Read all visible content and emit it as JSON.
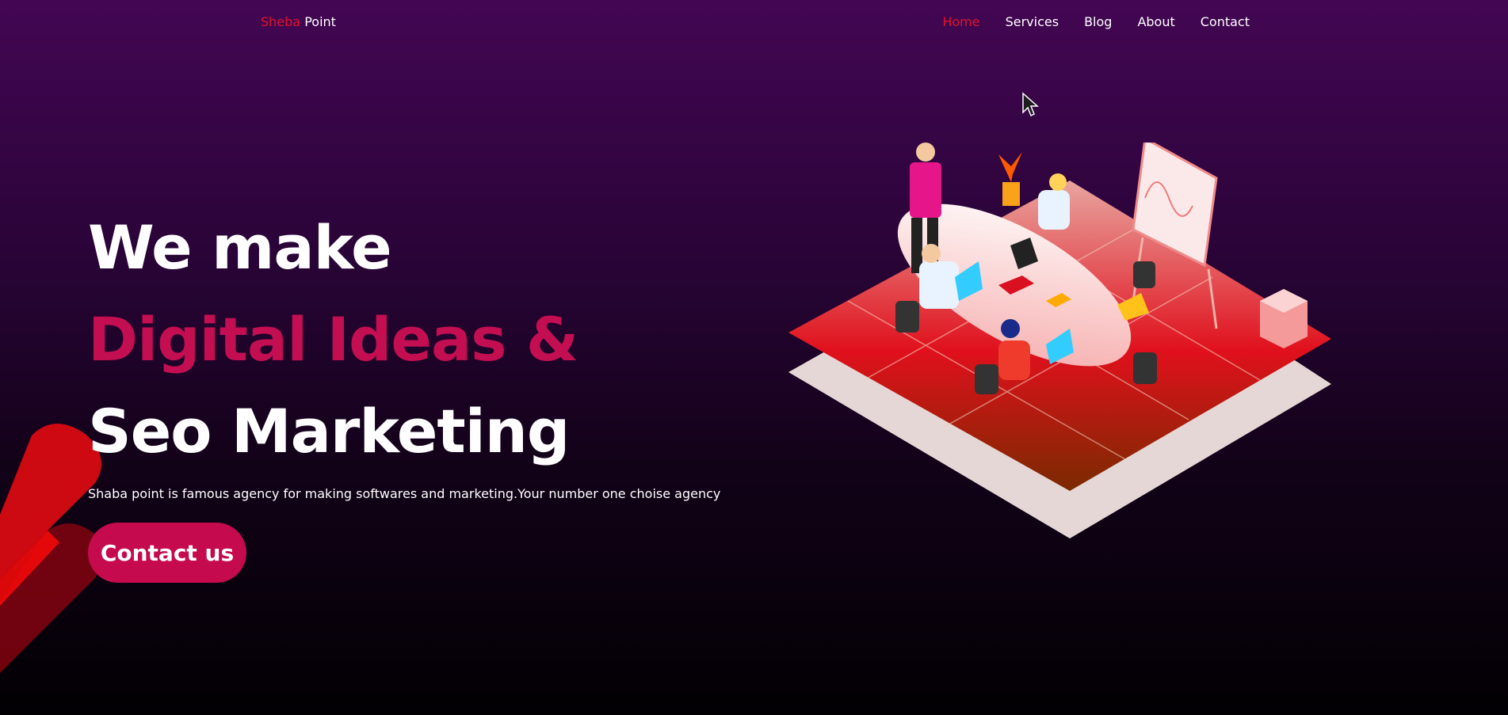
{
  "nav": {
    "brand_part1": "Sheba",
    "brand_part2": "Point",
    "links": [
      "Home",
      "Services",
      "Blog",
      "About",
      "Contact"
    ],
    "active": "Home"
  },
  "hero": {
    "line1": "We make",
    "line2": "Digital Ideas &",
    "line3": "Seo Marketing",
    "subtitle": "Shaba point is famous agency for making softwares and marketing.Your number one choise agency",
    "cta_label": "Contact us"
  },
  "colors": {
    "accent_red": "#e3122b",
    "accent_pink": "#c40e52",
    "button": "#c50a4e",
    "bg_top": "#430653",
    "bg_bottom": "#020003"
  },
  "icons": [
    "mouse-cursor-icon"
  ]
}
